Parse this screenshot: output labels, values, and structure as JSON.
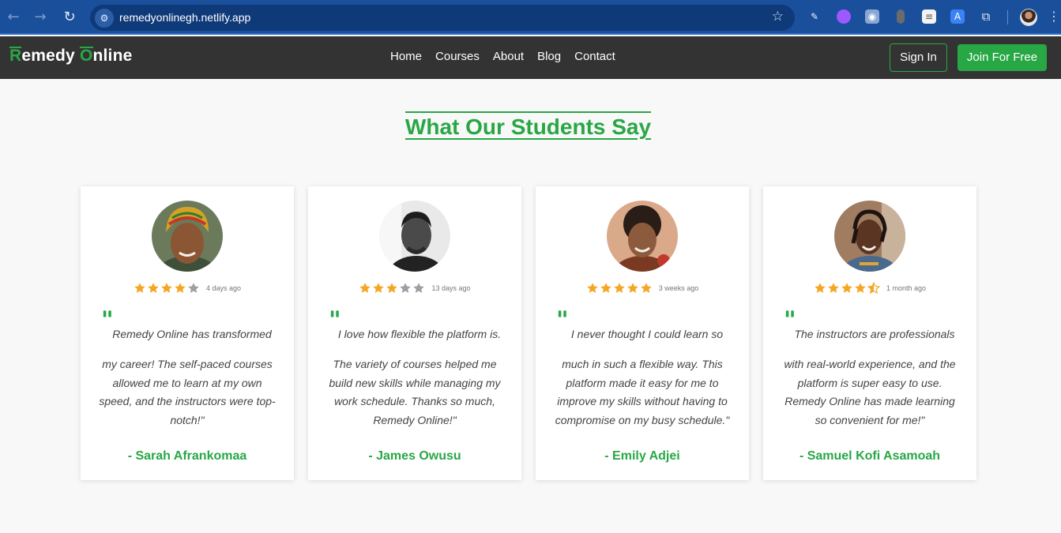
{
  "browser": {
    "back_icon": "←",
    "forward_icon": "→",
    "reload_icon": "↻",
    "site_info_icon": "⚙",
    "url": "remedyonlinegh.netlify.app",
    "bookmark_icon": "☆",
    "menu_icon": "⋮"
  },
  "header": {
    "logo_first_letter": "R",
    "logo_first_rest": "emedy ",
    "logo_second_letter": "O",
    "logo_second_rest": "nline",
    "nav": [
      "Home",
      "Courses",
      "About",
      "Blog",
      "Contact"
    ],
    "signin_label": "Sign In",
    "join_label": "Join For Free"
  },
  "section": {
    "title": "What Our Students Say"
  },
  "testimonials": [
    {
      "rating": 4,
      "time": "4 days ago",
      "quote_first": "Remedy Online has transformed",
      "quote_rest": "my career! The self-paced courses allowed me to learn at my own speed, and the instructors were top-notch!\"",
      "author": "- Sarah Afrankomaa"
    },
    {
      "rating": 3,
      "time": "13 days ago",
      "quote_first": "I love how flexible the platform is.",
      "quote_rest": "The variety of courses helped me build new skills while managing my work schedule. Thanks so much, Remedy Online!\"",
      "author": "- James Owusu"
    },
    {
      "rating": 5,
      "time": "3 weeks ago",
      "quote_first": "I never thought I could learn so",
      "quote_rest": "much in such a flexible way. This platform made it easy for me to improve my skills without having to compromise on my busy schedule.\"",
      "author": "- Emily Adjei"
    },
    {
      "rating": 4.5,
      "time": "1 month ago",
      "quote_first": "The instructors are professionals",
      "quote_rest": "with real-world experience, and the platform is super easy to use. Remedy Online has made learning so convenient for me!\"",
      "author": "- Samuel Kofi Asamoah"
    }
  ],
  "colors": {
    "brand_green": "#28a745",
    "star_filled": "#f5a623",
    "star_empty": "#9aa0a6",
    "header_bg": "#333333",
    "browser_bg": "#1a4f9c"
  }
}
